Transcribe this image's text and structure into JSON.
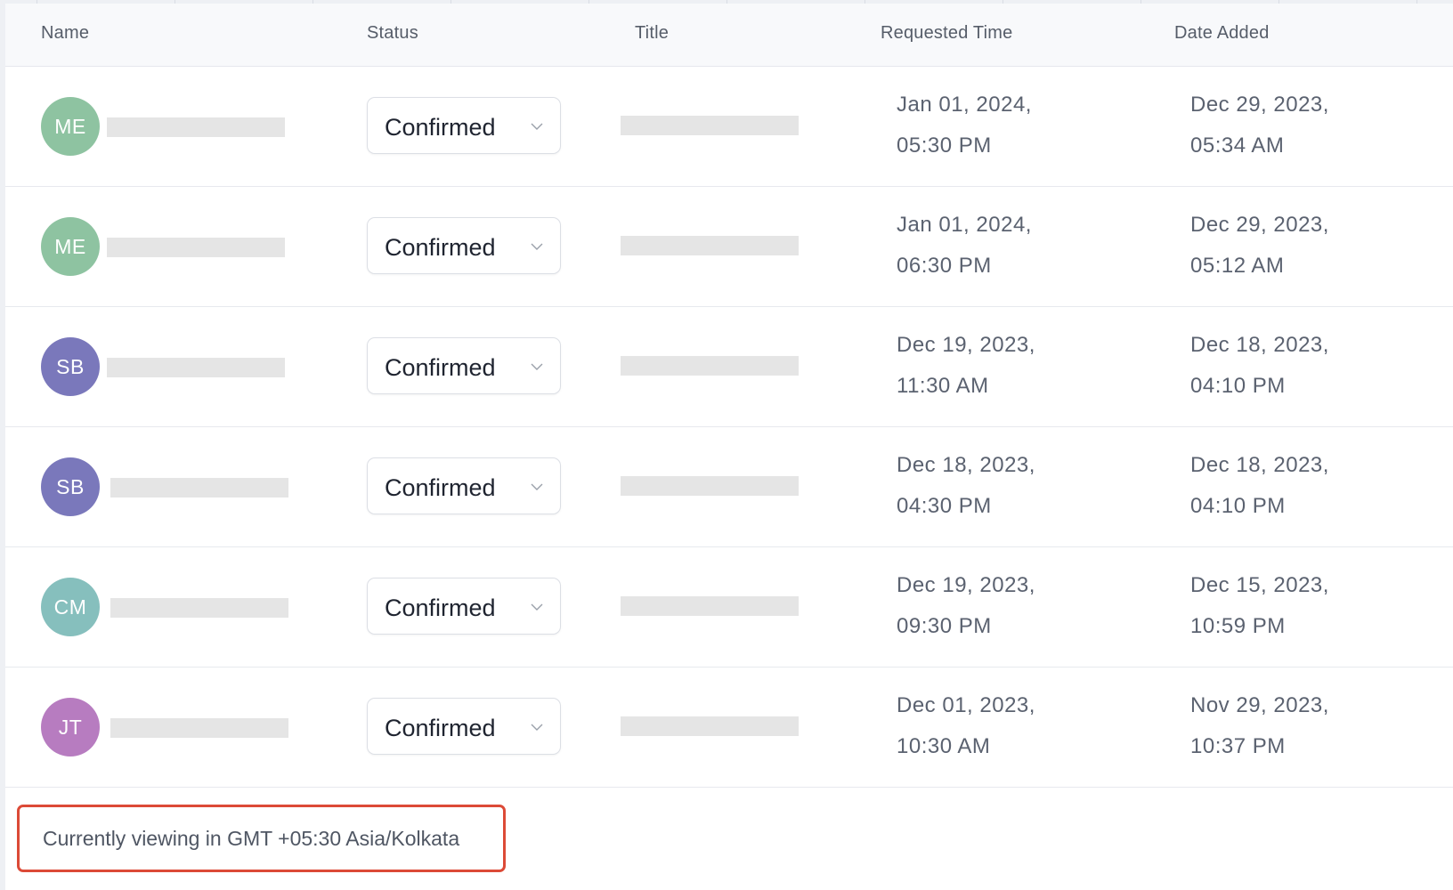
{
  "table": {
    "columns": {
      "name": "Name",
      "status": "Status",
      "title": "Title",
      "requested_time": "Requested Time",
      "date_added": "Date Added"
    },
    "rows": [
      {
        "initials": "ME",
        "avatar_color": "#8ec3a1",
        "status": "Confirmed",
        "requested_date": "Jan 01, 2024,",
        "requested_time": "05:30 PM",
        "added_date": "Dec 29, 2023,",
        "added_time": "05:34 AM"
      },
      {
        "initials": "ME",
        "avatar_color": "#8ec3a1",
        "status": "Confirmed",
        "requested_date": "Jan 01, 2024,",
        "requested_time": "06:30 PM",
        "added_date": "Dec 29, 2023,",
        "added_time": "05:12 AM"
      },
      {
        "initials": "SB",
        "avatar_color": "#7a78bb",
        "status": "Confirmed",
        "requested_date": "Dec 19, 2023,",
        "requested_time": "11:30 AM",
        "added_date": "Dec 18, 2023,",
        "added_time": "04:10 PM"
      },
      {
        "initials": "SB",
        "avatar_color": "#7a78bb",
        "status": "Confirmed",
        "requested_date": "Dec 18, 2023,",
        "requested_time": "04:30 PM",
        "added_date": "Dec 18, 2023,",
        "added_time": "04:10 PM"
      },
      {
        "initials": "CM",
        "avatar_color": "#86bfbd",
        "status": "Confirmed",
        "requested_date": "Dec 19, 2023,",
        "requested_time": "09:30 PM",
        "added_date": "Dec 15, 2023,",
        "added_time": "10:59 PM"
      },
      {
        "initials": "JT",
        "avatar_color": "#b77cc0",
        "status": "Confirmed",
        "requested_date": "Dec 01, 2023,",
        "requested_time": "10:30 AM",
        "added_date": "Nov 29, 2023,",
        "added_time": "10:37 PM"
      }
    ]
  },
  "footer": {
    "timezone_note": "Currently viewing in GMT +05:30 Asia/Kolkata",
    "highlight_color": "#dc4a37"
  }
}
